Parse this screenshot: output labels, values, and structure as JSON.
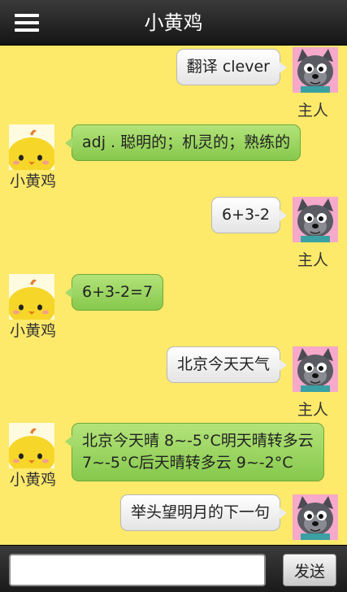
{
  "header": {
    "title": "小黄鸡",
    "menu_icon": "hamburger-menu-icon"
  },
  "chat": {
    "user_name": "主人",
    "bot_name": "小黄鸡",
    "messages": [
      {
        "from": "user",
        "text": "翻译 clever"
      },
      {
        "from": "bot",
        "text": "adj . 聪明的；机灵的；熟练的"
      },
      {
        "from": "user",
        "text": "6+3-2"
      },
      {
        "from": "bot",
        "text": "6+3-2=7"
      },
      {
        "from": "user",
        "text": "北京今天天气"
      },
      {
        "from": "bot",
        "line1": "北京今天晴 8~-5°C明天晴转多云",
        "line2": "7~-5°C后天晴转多云 9~-2°C"
      },
      {
        "from": "user",
        "text": "举头望明月的下一句"
      }
    ]
  },
  "composer": {
    "input_value": "",
    "send_label": "发送"
  },
  "colors": {
    "background": "#fde96a",
    "bot_bubble": "#9ad65f",
    "user_bubble": "#f2f2f2",
    "bar": "#222222"
  }
}
